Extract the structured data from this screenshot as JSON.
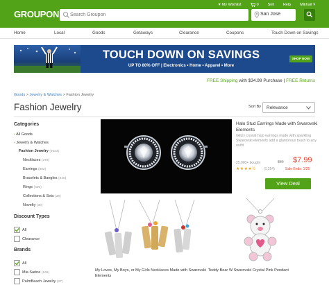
{
  "header": {
    "logo": "GROUPON",
    "search_placeholder": "Search Groupon",
    "location": "San Jose",
    "links": [
      {
        "label": "My Wishlist",
        "icon": "heart-icon"
      },
      {
        "label": "0",
        "icon": "cart-icon"
      },
      {
        "label": "Sell"
      },
      {
        "label": "Help"
      },
      {
        "label": "Mikhail",
        "icon": "chevron-down-icon"
      }
    ]
  },
  "nav": [
    "Home",
    "Local",
    "Goods",
    "Getaways",
    "Clearance",
    "Coupons",
    "Touch Down on Savings"
  ],
  "banner": {
    "headline": "TOUCH DOWN ON SAVINGS",
    "subline": "UP TO 80% OFF | Electronics • Home • Apparel • More",
    "button": "SHOP NOW"
  },
  "promo": {
    "part1": "FREE Shipping",
    "part2": " with $34.99 Purchase | ",
    "part3": "FREE Returns"
  },
  "breadcrumb": {
    "items": [
      "Goods",
      "Jewelry & Watches",
      "Fashion Jewelry"
    ],
    "separator": ">"
  },
  "page_title": "Fashion Jewelry",
  "sort": {
    "label": "Sort By",
    "value": "Relevance"
  },
  "sidebar": {
    "categories_heading": "Categories",
    "back_all": "All Goods",
    "back_parent": "Jewelry & Watches",
    "current": {
      "label": "Fashion Jewelry",
      "count": "(3024)"
    },
    "subcategories": [
      {
        "label": "Necklaces",
        "count": "(378)"
      },
      {
        "label": "Earrings",
        "count": "(882)"
      },
      {
        "label": "Bracelets & Bangles",
        "count": "(840)"
      },
      {
        "label": "Rings",
        "count": "(400)"
      },
      {
        "label": "Collections & Sets",
        "count": "(38)"
      },
      {
        "label": "Novelty",
        "count": "(30)"
      }
    ],
    "discount_heading": "Discount Types",
    "discount_options": [
      {
        "label": "All",
        "checked": true
      },
      {
        "label": "Clearance",
        "checked": false
      }
    ],
    "brands_heading": "Brands",
    "brand_options": [
      {
        "label": "All",
        "checked": true
      },
      {
        "label": "Mia Sarine",
        "count": "(165)",
        "checked": false
      },
      {
        "label": "PalmBeach Jewelry",
        "count": "(37)",
        "checked": false
      }
    ]
  },
  "featured": {
    "title": "Halo Stud Earrings Made with Swarovski Elements",
    "description": "Glitzy crystal halo earrings made with sparkling Swarovski elements add a glamorous touch to any outfit",
    "bought": "25,000+ bought",
    "original_price": "$80",
    "price": "$7.99",
    "rating": 4.5,
    "stars": "★★★★½",
    "rating_count": "(1,254)",
    "sale_ends": "Sale Ends: 1/25",
    "button": "View Deal",
    "colors": {
      "price": "#e8412c",
      "stars": "#e8a317"
    }
  },
  "products": [
    {
      "title": "My Loves, My Boys, or My Girls Necklaces Made with Swarovski Elements"
    },
    {
      "title": "Teddy Bear W Swarovski Crystal Pink Pendant"
    }
  ],
  "colors": {
    "brand_green": "#53a318",
    "dark_green": "#357e0b",
    "link_blue": "#3f7fc0",
    "banner_blue": "#1c4a8c"
  }
}
